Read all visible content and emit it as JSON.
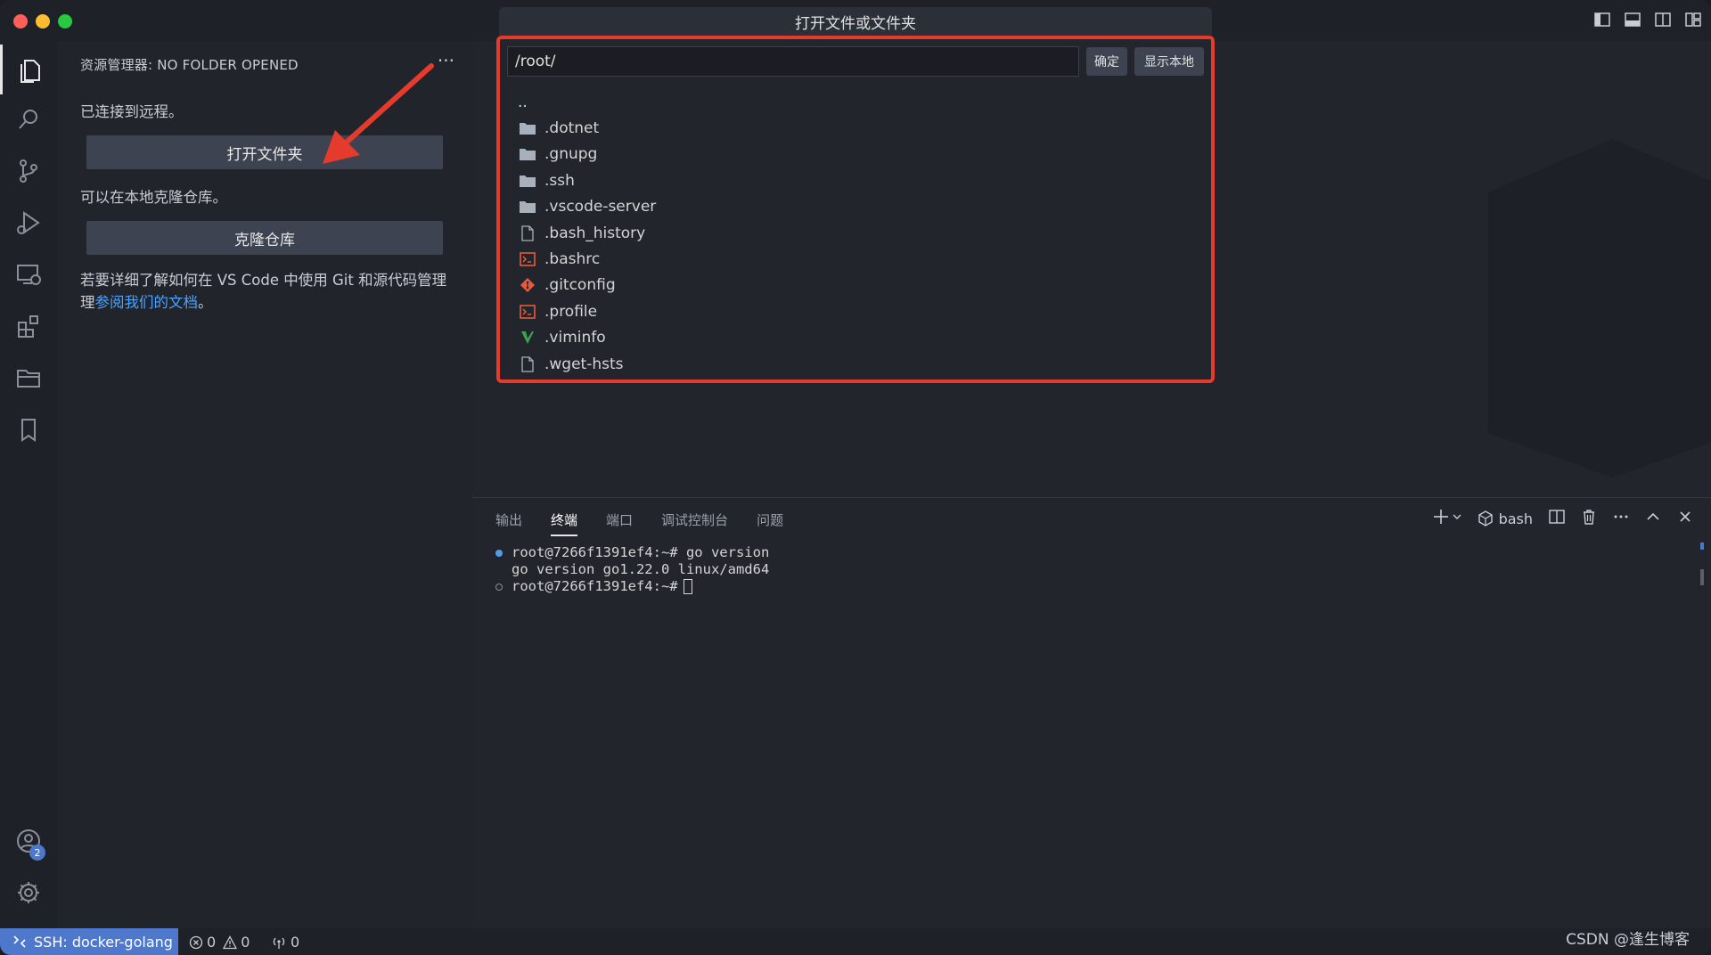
{
  "quickpick": {
    "title": "打开文件或文件夹",
    "input_value": "/root/",
    "ok_label": "确定",
    "show_local_label": "显示本地",
    "items": [
      {
        "label": "..",
        "icon": "none"
      },
      {
        "label": ".dotnet",
        "icon": "folder-icon"
      },
      {
        "label": ".gnupg",
        "icon": "folder-icon"
      },
      {
        "label": ".ssh",
        "icon": "folder-icon"
      },
      {
        "label": ".vscode-server",
        "icon": "folder-icon"
      },
      {
        "label": ".bash_history",
        "icon": "file-icon"
      },
      {
        "label": ".bashrc",
        "icon": "terminal-file-icon"
      },
      {
        "label": ".gitconfig",
        "icon": "git-icon"
      },
      {
        "label": ".profile",
        "icon": "terminal-file-icon"
      },
      {
        "label": ".viminfo",
        "icon": "vim-icon"
      },
      {
        "label": ".wget-hsts",
        "icon": "file-icon"
      }
    ]
  },
  "sidebar": {
    "header": "资源管理器: NO FOLDER OPENED",
    "more": "···",
    "connected_text": "已连接到远程。",
    "open_folder_label": "打开文件夹",
    "clone_hint": "可以在本地克隆仓库。",
    "clone_label": "克隆仓库",
    "help_text_1": "若要详细了解如何在 VS Code 中使用 Git 和源代码管理",
    "help_text_2": "理",
    "help_link": "参阅我们的文档",
    "help_text_3": "。"
  },
  "activity": {
    "accounts_badge": "2"
  },
  "panel": {
    "tabs": [
      "输出",
      "终端",
      "端口",
      "调试控制台",
      "问题"
    ],
    "active_tab": "终端",
    "shell_label": "bash",
    "terminal": {
      "line1": "root@7266f1391ef4:~# go version",
      "line2": "go version go1.22.0 linux/amd64",
      "line3": "root@7266f1391ef4:~# "
    }
  },
  "statusbar": {
    "remote": "SSH: docker-golang",
    "errors": "0",
    "warnings": "0",
    "ports": "0"
  },
  "watermark": "CSDN @逢生博客",
  "colors": {
    "accent": "#4d78cc",
    "annotation": "#e53b2c"
  }
}
